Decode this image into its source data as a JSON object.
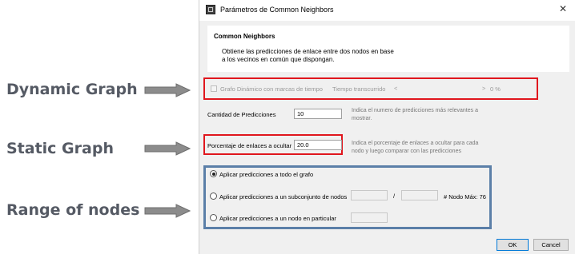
{
  "annotations": {
    "dynamic": "Dynamic Graph",
    "static": "Static Graph",
    "range": "Range of nodes"
  },
  "window": {
    "title": "Parámetros de Common Neighbors",
    "close_glyph": "✕"
  },
  "panel": {
    "title": "Common Neighbors",
    "description": "Obtiene las predicciones de enlace entre dos nodos en base a los vecinos en común que dispongan."
  },
  "dynamic": {
    "checkbox_label": "Grafo Dinámico con marcas de tiempo",
    "time_label": "Tiempo transcurrido",
    "left_arrow": "<",
    "right_arrow": ">",
    "percent": "0 %"
  },
  "predictions": {
    "label": "Cantidad de Predicciones",
    "value": "10",
    "help": "Indica el numero de predicciones más relevantes a mostrar."
  },
  "percentage": {
    "label": "Porcentaje de enlaces a ocultar",
    "value": "20.0",
    "help": "Indica el porcentaje de enlaces a ocultar para cada nodo y luego comparar con las predicciones"
  },
  "range": {
    "option_all": "Aplicar predicciones a todo el grafo",
    "option_subset": "Aplicar predicciones a un subconjunto de nodos",
    "slash": "/",
    "max_node": "# Nodo Máx: 76",
    "option_single": "Aplicar predicciones a un nodo en particular"
  },
  "buttons": {
    "ok": "OK",
    "cancel": "Cancel"
  },
  "colors": {
    "highlight_red": "#e0161d",
    "highlight_blue": "#5b7fa8",
    "annotation_text": "#555a64"
  }
}
